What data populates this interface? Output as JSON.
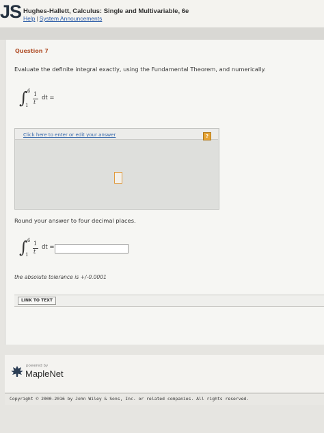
{
  "header": {
    "logo_text": "JS",
    "book_title": "Hughes-Hallett, Calculus: Single and Multivariable, 6e",
    "links": [
      "Help",
      "System Announcements"
    ],
    "link_separator": "|"
  },
  "question": {
    "title": "Question 7",
    "prompt": "Evaluate the definite integral exactly, using the Fundamental Theorem, and numerically.",
    "integral": {
      "lower": "1",
      "upper": "6",
      "numerator": "1",
      "denominator": "t",
      "tail": "dt ="
    },
    "applet": {
      "link_text": "Click here to enter or edit your answer",
      "help_icon": "?"
    },
    "round_instruction": "Round your answer to four decimal places.",
    "numeric_answer_value": "",
    "tolerance_text": "the absolute tolerance is +/-0.0001",
    "link_to_text_label": "LINK TO TEXT"
  },
  "footer": {
    "powered_by": "powered by",
    "brand": "MapleNet",
    "brand_icon": "maple-leaf-icon",
    "copyright": "Copyright © 2000-2016 by John Wiley & Sons, Inc. or related companies. All rights reserved."
  },
  "colors": {
    "question_title": "#b1512b",
    "link": "#2f5ea8",
    "help_icon": "#e6a436"
  }
}
